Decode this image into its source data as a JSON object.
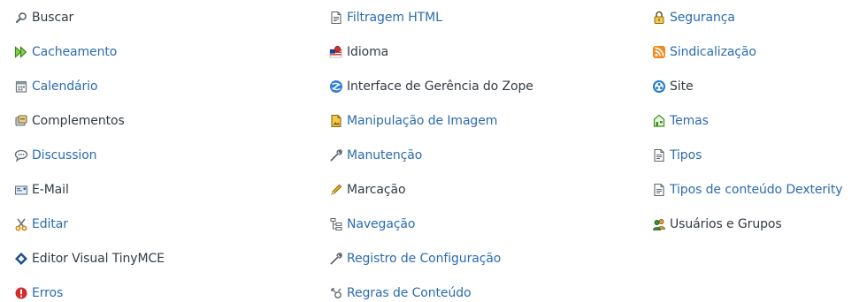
{
  "columns": [
    [
      {
        "label": "Buscar",
        "icon": "search-icon"
      },
      {
        "label": "Cacheamento",
        "icon": "cache-icon"
      },
      {
        "label": "Calendário",
        "icon": "calendar-icon"
      },
      {
        "label": "Complementos",
        "icon": "addons-icon"
      },
      {
        "label": "Discussion",
        "icon": "discussion-icon"
      },
      {
        "label": "E-Mail",
        "icon": "mail-icon"
      },
      {
        "label": "Editar",
        "icon": "scissors-icon"
      },
      {
        "label": "Editor Visual TinyMCE",
        "icon": "tinymce-icon"
      },
      {
        "label": "Erros",
        "icon": "error-icon"
      }
    ],
    [
      {
        "label": "Filtragem HTML",
        "icon": "html-filter-icon"
      },
      {
        "label": "Idioma",
        "icon": "language-icon"
      },
      {
        "label": "Interface de Gerência do Zope",
        "icon": "zope-icon"
      },
      {
        "label": "Manipulação de Imagem",
        "icon": "image-icon"
      },
      {
        "label": "Manutenção",
        "icon": "wrench-icon"
      },
      {
        "label": "Marcação",
        "icon": "pencil-icon"
      },
      {
        "label": "Navegação",
        "icon": "navigation-icon"
      },
      {
        "label": "Registro de Configuração",
        "icon": "wrench-icon"
      },
      {
        "label": "Regras de Conteúdo",
        "icon": "content-rules-icon"
      }
    ],
    [
      {
        "label": "Segurança",
        "icon": "lock-icon"
      },
      {
        "label": "Sindicalização",
        "icon": "rss-icon"
      },
      {
        "label": "Site",
        "icon": "site-icon"
      },
      {
        "label": "Temas",
        "icon": "themes-icon"
      },
      {
        "label": "Tipos",
        "icon": "document-icon"
      },
      {
        "label": "Tipos de conteúdo Dexterity",
        "icon": "document-icon"
      },
      {
        "label": "Usuários e Grupos",
        "icon": "users-icon"
      }
    ]
  ],
  "colors": {
    "link": "#2b6cb0",
    "text": "#333b44"
  }
}
